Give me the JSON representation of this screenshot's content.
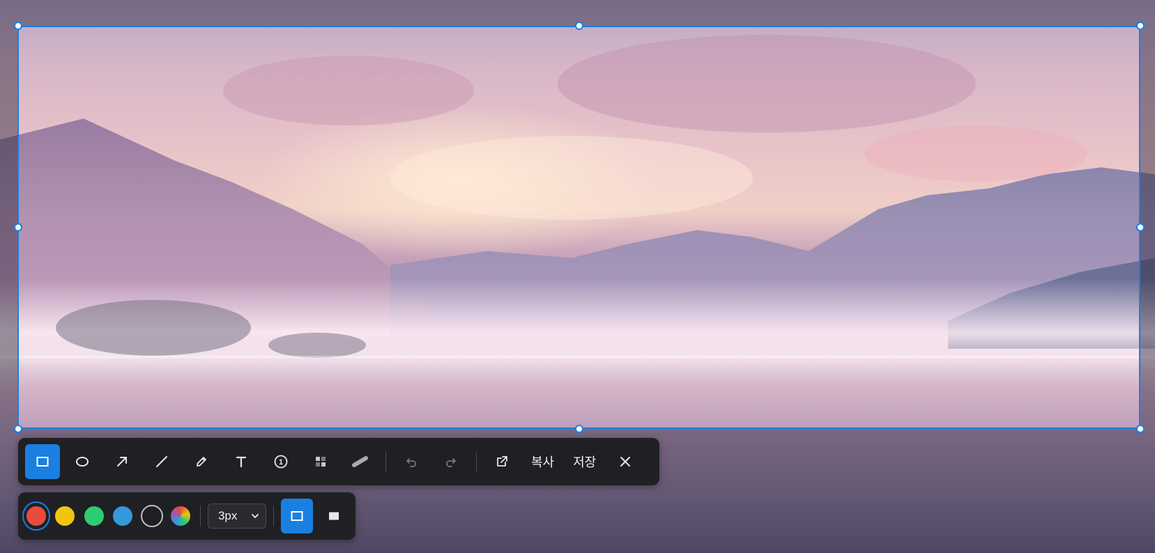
{
  "toolbar": {
    "tools": [
      {
        "name": "rectangle-tool",
        "icon": "square-outline-icon"
      },
      {
        "name": "ellipse-tool",
        "icon": "ellipse-icon"
      },
      {
        "name": "arrow-tool",
        "icon": "arrow-icon"
      },
      {
        "name": "line-tool",
        "icon": "line-icon"
      },
      {
        "name": "pen-tool",
        "icon": "pencil-icon"
      },
      {
        "name": "text-tool",
        "icon": "text-icon"
      },
      {
        "name": "number-tool",
        "icon": "numbered-circle-icon"
      },
      {
        "name": "mosaic-tool",
        "icon": "mosaic-icon"
      },
      {
        "name": "highlighter-tool",
        "icon": "highlighter-icon"
      }
    ],
    "active_tool": "rectangle-tool",
    "number_label": "1",
    "copy_label": "복사",
    "save_label": "저장"
  },
  "style_panel": {
    "colors": [
      "#e74c3c",
      "#f1c40f",
      "#2ecc71",
      "#3498db",
      "#1f2024"
    ],
    "selected_color": "#e74c3c",
    "stroke_width": "3px",
    "fill_modes": [
      "outline",
      "filled"
    ],
    "selected_fill_mode": "outline"
  },
  "accent": "#1a7fe0"
}
